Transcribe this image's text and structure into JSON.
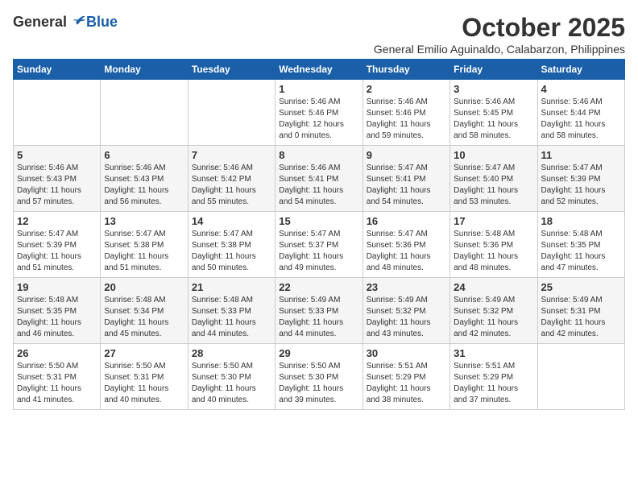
{
  "logo": {
    "general": "General",
    "blue": "Blue"
  },
  "header": {
    "month": "October 2025",
    "subtitle": "General Emilio Aguinaldo, Calabarzon, Philippines"
  },
  "weekdays": [
    "Sunday",
    "Monday",
    "Tuesday",
    "Wednesday",
    "Thursday",
    "Friday",
    "Saturday"
  ],
  "weeks": [
    [
      {
        "day": "",
        "info": ""
      },
      {
        "day": "",
        "info": ""
      },
      {
        "day": "",
        "info": ""
      },
      {
        "day": "1",
        "info": "Sunrise: 5:46 AM\nSunset: 5:46 PM\nDaylight: 12 hours\nand 0 minutes."
      },
      {
        "day": "2",
        "info": "Sunrise: 5:46 AM\nSunset: 5:46 PM\nDaylight: 11 hours\nand 59 minutes."
      },
      {
        "day": "3",
        "info": "Sunrise: 5:46 AM\nSunset: 5:45 PM\nDaylight: 11 hours\nand 58 minutes."
      },
      {
        "day": "4",
        "info": "Sunrise: 5:46 AM\nSunset: 5:44 PM\nDaylight: 11 hours\nand 58 minutes."
      }
    ],
    [
      {
        "day": "5",
        "info": "Sunrise: 5:46 AM\nSunset: 5:43 PM\nDaylight: 11 hours\nand 57 minutes."
      },
      {
        "day": "6",
        "info": "Sunrise: 5:46 AM\nSunset: 5:43 PM\nDaylight: 11 hours\nand 56 minutes."
      },
      {
        "day": "7",
        "info": "Sunrise: 5:46 AM\nSunset: 5:42 PM\nDaylight: 11 hours\nand 55 minutes."
      },
      {
        "day": "8",
        "info": "Sunrise: 5:46 AM\nSunset: 5:41 PM\nDaylight: 11 hours\nand 54 minutes."
      },
      {
        "day": "9",
        "info": "Sunrise: 5:47 AM\nSunset: 5:41 PM\nDaylight: 11 hours\nand 54 minutes."
      },
      {
        "day": "10",
        "info": "Sunrise: 5:47 AM\nSunset: 5:40 PM\nDaylight: 11 hours\nand 53 minutes."
      },
      {
        "day": "11",
        "info": "Sunrise: 5:47 AM\nSunset: 5:39 PM\nDaylight: 11 hours\nand 52 minutes."
      }
    ],
    [
      {
        "day": "12",
        "info": "Sunrise: 5:47 AM\nSunset: 5:39 PM\nDaylight: 11 hours\nand 51 minutes."
      },
      {
        "day": "13",
        "info": "Sunrise: 5:47 AM\nSunset: 5:38 PM\nDaylight: 11 hours\nand 51 minutes."
      },
      {
        "day": "14",
        "info": "Sunrise: 5:47 AM\nSunset: 5:38 PM\nDaylight: 11 hours\nand 50 minutes."
      },
      {
        "day": "15",
        "info": "Sunrise: 5:47 AM\nSunset: 5:37 PM\nDaylight: 11 hours\nand 49 minutes."
      },
      {
        "day": "16",
        "info": "Sunrise: 5:47 AM\nSunset: 5:36 PM\nDaylight: 11 hours\nand 48 minutes."
      },
      {
        "day": "17",
        "info": "Sunrise: 5:48 AM\nSunset: 5:36 PM\nDaylight: 11 hours\nand 48 minutes."
      },
      {
        "day": "18",
        "info": "Sunrise: 5:48 AM\nSunset: 5:35 PM\nDaylight: 11 hours\nand 47 minutes."
      }
    ],
    [
      {
        "day": "19",
        "info": "Sunrise: 5:48 AM\nSunset: 5:35 PM\nDaylight: 11 hours\nand 46 minutes."
      },
      {
        "day": "20",
        "info": "Sunrise: 5:48 AM\nSunset: 5:34 PM\nDaylight: 11 hours\nand 45 minutes."
      },
      {
        "day": "21",
        "info": "Sunrise: 5:48 AM\nSunset: 5:33 PM\nDaylight: 11 hours\nand 44 minutes."
      },
      {
        "day": "22",
        "info": "Sunrise: 5:49 AM\nSunset: 5:33 PM\nDaylight: 11 hours\nand 44 minutes."
      },
      {
        "day": "23",
        "info": "Sunrise: 5:49 AM\nSunset: 5:32 PM\nDaylight: 11 hours\nand 43 minutes."
      },
      {
        "day": "24",
        "info": "Sunrise: 5:49 AM\nSunset: 5:32 PM\nDaylight: 11 hours\nand 42 minutes."
      },
      {
        "day": "25",
        "info": "Sunrise: 5:49 AM\nSunset: 5:31 PM\nDaylight: 11 hours\nand 42 minutes."
      }
    ],
    [
      {
        "day": "26",
        "info": "Sunrise: 5:50 AM\nSunset: 5:31 PM\nDaylight: 11 hours\nand 41 minutes."
      },
      {
        "day": "27",
        "info": "Sunrise: 5:50 AM\nSunset: 5:31 PM\nDaylight: 11 hours\nand 40 minutes."
      },
      {
        "day": "28",
        "info": "Sunrise: 5:50 AM\nSunset: 5:30 PM\nDaylight: 11 hours\nand 40 minutes."
      },
      {
        "day": "29",
        "info": "Sunrise: 5:50 AM\nSunset: 5:30 PM\nDaylight: 11 hours\nand 39 minutes."
      },
      {
        "day": "30",
        "info": "Sunrise: 5:51 AM\nSunset: 5:29 PM\nDaylight: 11 hours\nand 38 minutes."
      },
      {
        "day": "31",
        "info": "Sunrise: 5:51 AM\nSunset: 5:29 PM\nDaylight: 11 hours\nand 37 minutes."
      },
      {
        "day": "",
        "info": ""
      }
    ]
  ]
}
